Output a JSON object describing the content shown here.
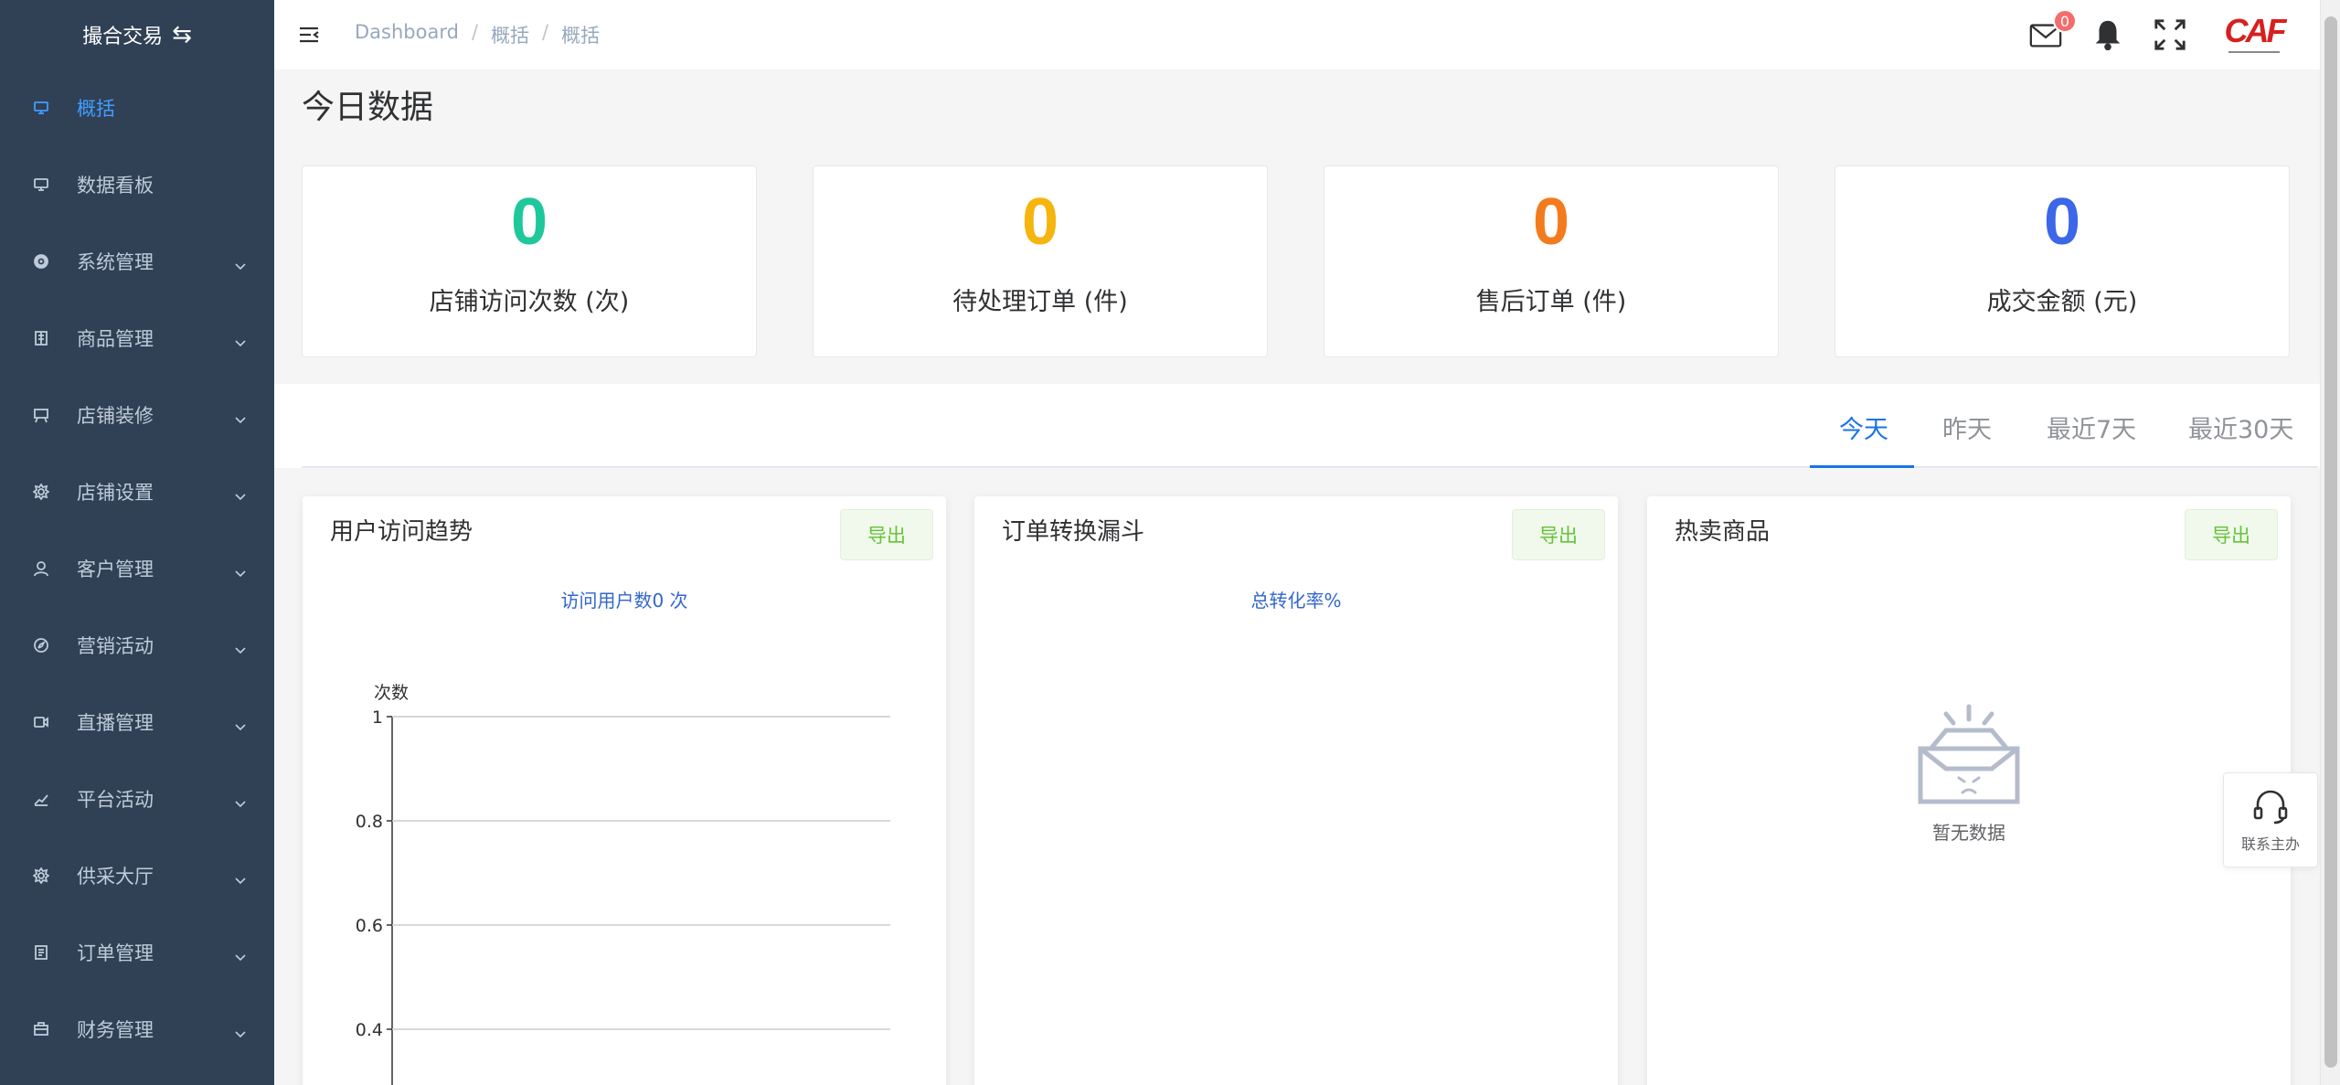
{
  "sidebar": {
    "title": "撮合交易",
    "items": [
      {
        "label": "概括",
        "icon": "monitor-icon",
        "active": true,
        "has_children": false
      },
      {
        "label": "数据看板",
        "icon": "monitor-icon",
        "active": false,
        "has_children": false
      },
      {
        "label": "系统管理",
        "icon": "gear-circle-icon",
        "active": false,
        "has_children": true
      },
      {
        "label": "商品管理",
        "icon": "building-icon",
        "active": false,
        "has_children": true
      },
      {
        "label": "店铺装修",
        "icon": "easel-icon",
        "active": false,
        "has_children": true
      },
      {
        "label": "店铺设置",
        "icon": "settings-icon",
        "active": false,
        "has_children": true
      },
      {
        "label": "客户管理",
        "icon": "user-icon",
        "active": false,
        "has_children": true
      },
      {
        "label": "营销活动",
        "icon": "compass-icon",
        "active": false,
        "has_children": true
      },
      {
        "label": "直播管理",
        "icon": "video-camera-icon",
        "active": false,
        "has_children": true
      },
      {
        "label": "平台活动",
        "icon": "chart-line-icon",
        "active": false,
        "has_children": true
      },
      {
        "label": "供采大厅",
        "icon": "settings-icon",
        "active": false,
        "has_children": true
      },
      {
        "label": "订单管理",
        "icon": "document-icon",
        "active": false,
        "has_children": true
      },
      {
        "label": "财务管理",
        "icon": "briefcase-icon",
        "active": false,
        "has_children": true
      }
    ]
  },
  "navbar": {
    "breadcrumb": [
      "Dashboard",
      "概括",
      "概括"
    ],
    "breadcrumb_sep": "/",
    "mail_badge": "0",
    "logo_text": "CAF"
  },
  "main": {
    "title": "今日数据",
    "stats": [
      {
        "value": "0",
        "label": "店铺访问次数 (次)",
        "color": "#1fc89a"
      },
      {
        "value": "0",
        "label": "待处理订单 (件)",
        "color": "#f5b50f"
      },
      {
        "value": "0",
        "label": "售后订单 (件)",
        "color": "#f37b1d"
      },
      {
        "value": "0",
        "label": "成交金额 (元)",
        "color": "#3b67e8"
      }
    ],
    "tabs": [
      "今天",
      "昨天",
      "最近7天",
      "最近30天"
    ],
    "active_tab": 0,
    "panels": [
      {
        "title": "用户访问趋势",
        "export_label": "导出",
        "subtitle": "访问用户数0 次"
      },
      {
        "title": "订单转换漏斗",
        "export_label": "导出",
        "subtitle": "总转化率%"
      },
      {
        "title": "热卖商品",
        "export_label": "导出",
        "empty_text": "暂无数据"
      }
    ]
  },
  "float_service": {
    "label": "联系主办"
  },
  "chart_data": {
    "type": "line",
    "title": "",
    "ylabel": "次数",
    "xlabel": "",
    "yticks": [
      "1",
      "0.8",
      "0.6",
      "0.4"
    ],
    "ylim": [
      0,
      1
    ],
    "grid": true,
    "series": []
  }
}
